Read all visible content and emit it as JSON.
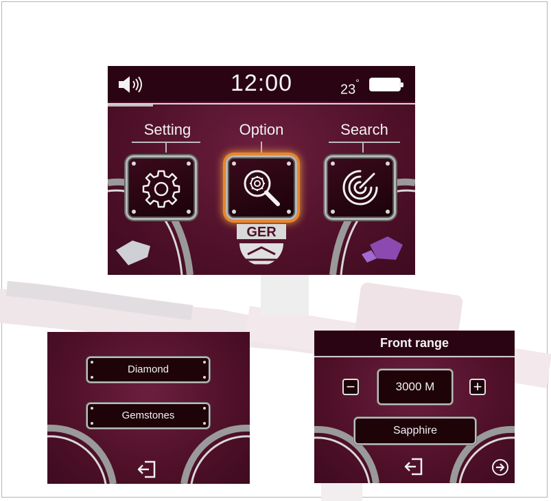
{
  "main_screen": {
    "status": {
      "time": "12:00",
      "temperature": "23",
      "temperature_unit": "°",
      "speaker_icon": "speaker-icon",
      "battery_icon": "battery-icon"
    },
    "menu": [
      {
        "label": "Setting",
        "icon": "gear-icon"
      },
      {
        "label": "Option",
        "icon": "gear-magnifier-icon",
        "selected": true
      },
      {
        "label": "Search",
        "icon": "radar-icon"
      }
    ],
    "logo_text": "GER"
  },
  "sub_screen_1": {
    "items": [
      "Diamond",
      "Gemstones"
    ],
    "back_icon": "exit-icon"
  },
  "sub_screen_2": {
    "title": "Front range",
    "range_value": "3000 M",
    "target": "Sapphire",
    "back_icon": "exit-icon",
    "next_icon": "arrow-right-circle-icon"
  },
  "colors": {
    "screen_bg": "#4f1028",
    "status_bar": "#2a0412",
    "highlight": "#e7862e"
  }
}
